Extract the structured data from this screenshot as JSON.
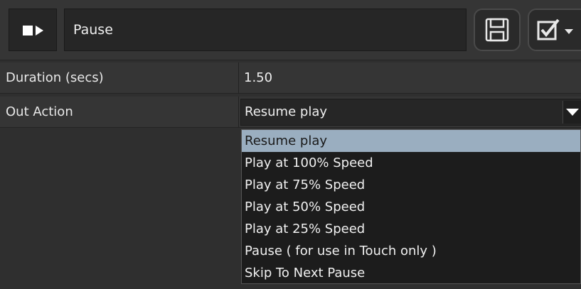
{
  "header": {
    "title": "Pause",
    "mode_icon": "stop-play-icon",
    "save_icon": "save-icon",
    "confirm_icon": "checkbox-icon"
  },
  "properties": {
    "duration": {
      "label": "Duration (secs)",
      "value": "1.50"
    },
    "out_action": {
      "label": "Out Action",
      "selected": "Resume play",
      "options": [
        "Resume play",
        "Play at 100% Speed",
        "Play at 75% Speed",
        "Play at 50% Speed",
        "Play at 25% Speed",
        "Pause ( for use in Touch only )",
        "Skip To Next Pause"
      ]
    }
  },
  "colors": {
    "background": "#2f2f2f",
    "highlight": "#9aaec0"
  }
}
